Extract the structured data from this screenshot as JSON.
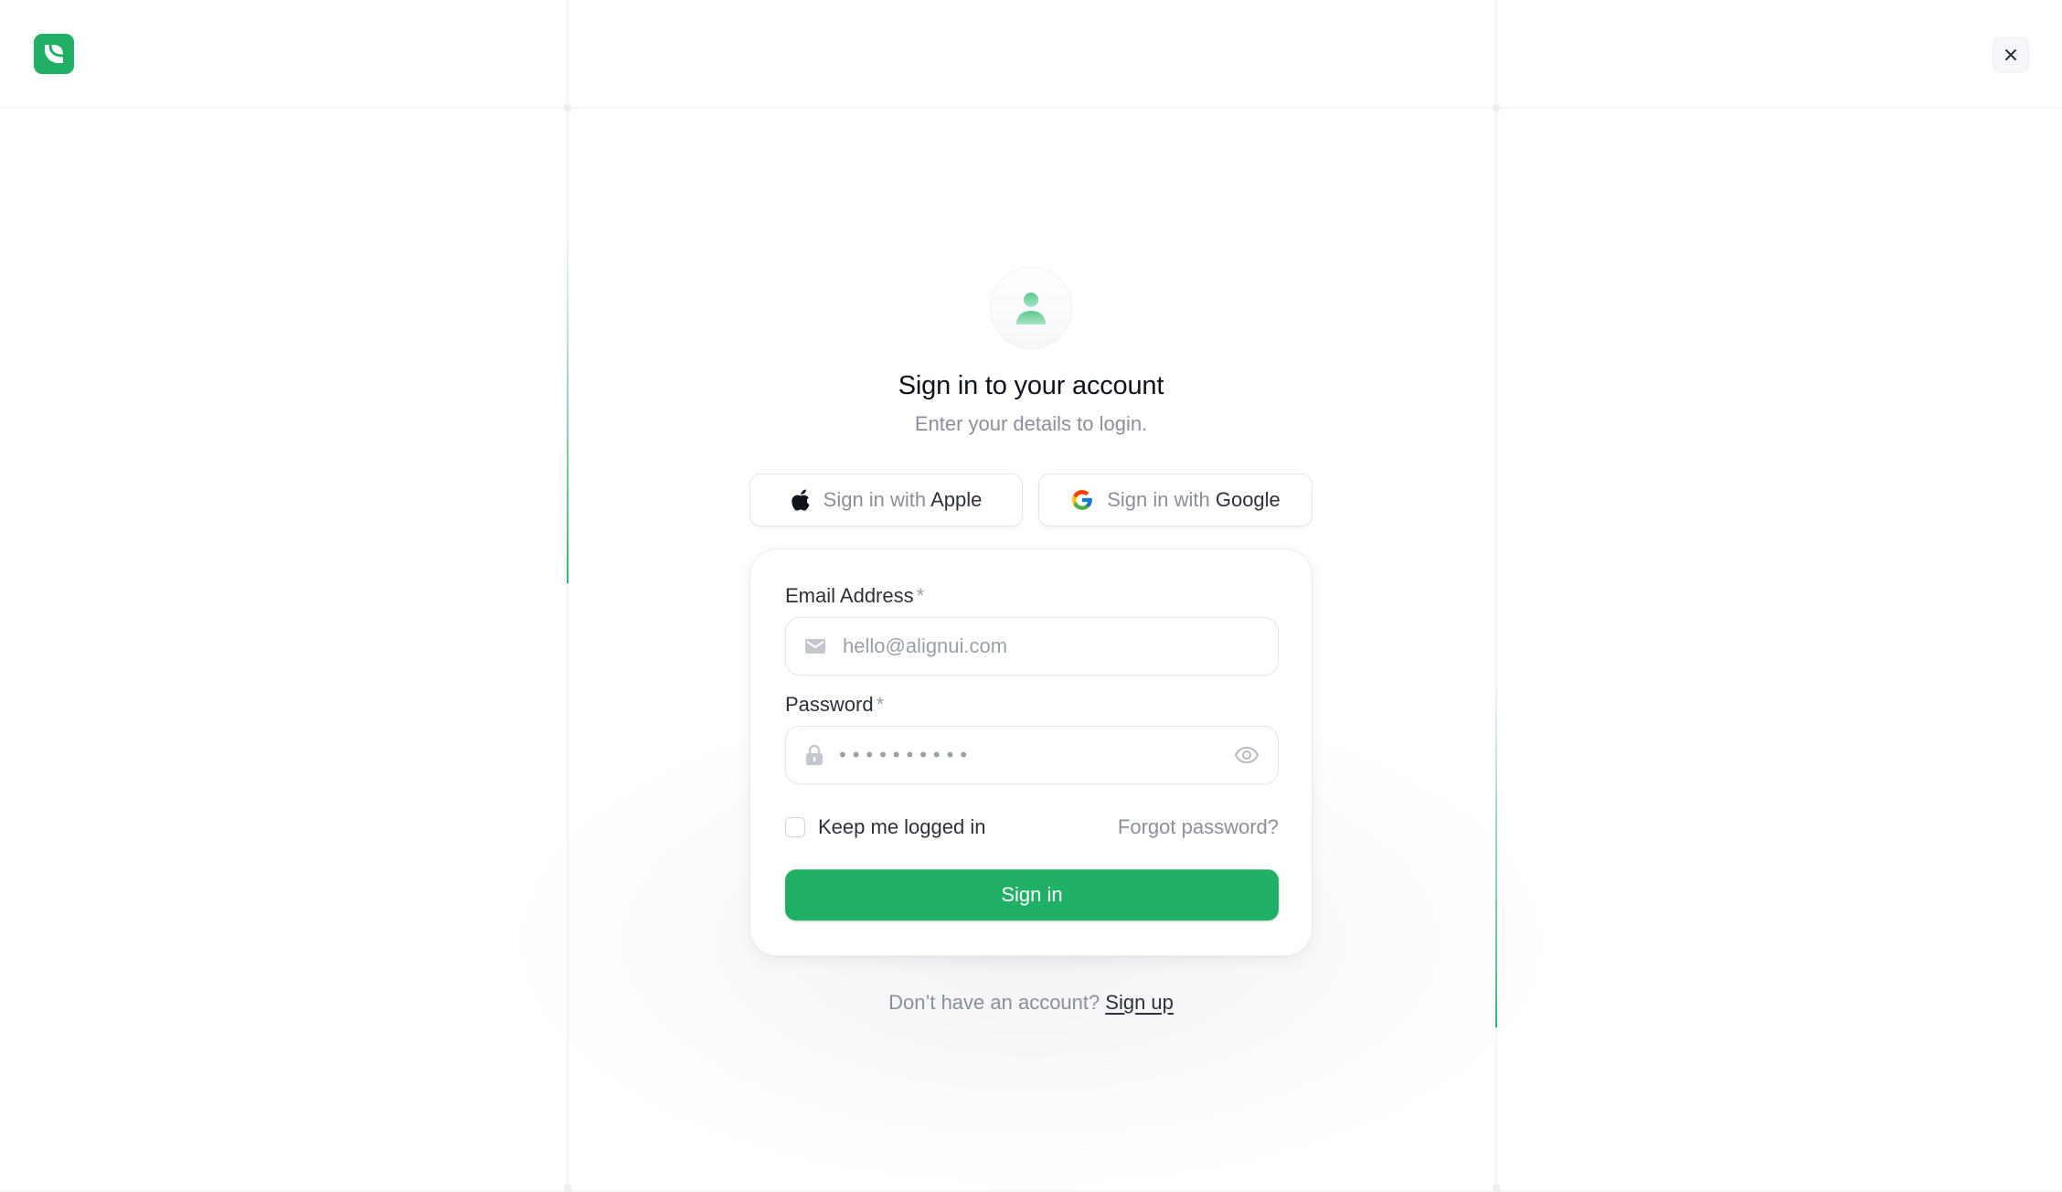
{
  "brand": {
    "logo_icon": "brand-logo-icon",
    "accent": "#1fb065"
  },
  "header": {
    "close_icon": "close-icon"
  },
  "heading": {
    "title": "Sign in to your account",
    "subtitle": "Enter your details to login.",
    "avatar_icon": "user-icon"
  },
  "social": {
    "apple": {
      "prefix": "Sign in with",
      "provider": "Apple",
      "icon": "apple-icon"
    },
    "google": {
      "prefix": "Sign in with",
      "provider": "Google",
      "icon": "google-icon"
    }
  },
  "form": {
    "email": {
      "label": "Email Address",
      "required_mark": "*",
      "placeholder": "hello@alignui.com",
      "value": "",
      "icon": "mail-icon"
    },
    "password": {
      "label": "Password",
      "required_mark": "*",
      "masked_value": "••••••••••",
      "icon": "lock-icon",
      "toggle_icon": "eye-icon"
    },
    "remember": {
      "label": "Keep me logged in",
      "checked": false
    },
    "forgot_label": "Forgot password?",
    "submit_label": "Sign in"
  },
  "footer": {
    "prompt": "Don’t have an account?",
    "link_label": "Sign up"
  }
}
